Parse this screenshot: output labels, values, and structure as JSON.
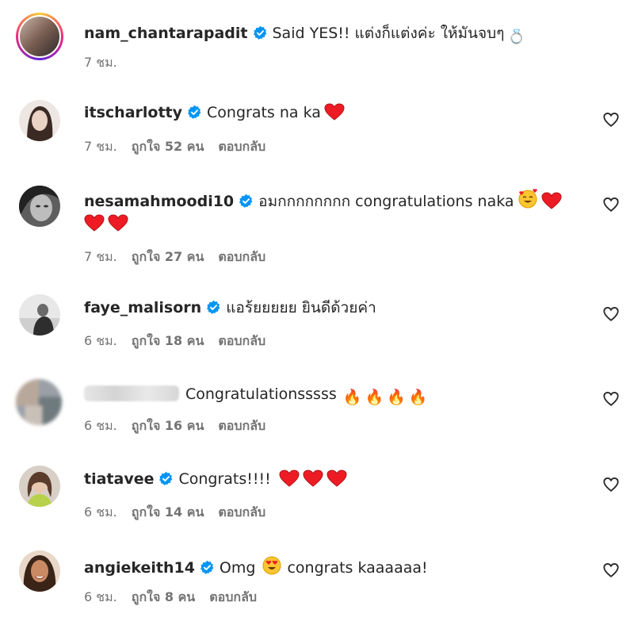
{
  "comments": [
    {
      "user": "nam_chantarapadit",
      "text": "Said YES!! แต่งก็แต่งค่ะ ให้มันจบๆ",
      "emoji": "💍",
      "time": "7 ชม."
    },
    {
      "user": "itscharlotty",
      "text": "Congrats na ka",
      "time": "7 ชม.",
      "likes": "ถูกใจ 52 คน",
      "reply": "ตอบกลับ"
    },
    {
      "user": "nesamahmoodi10",
      "text": "อมกกกกกกกก congratulations naka",
      "time": "7 ชม.",
      "likes": "ถูกใจ 27 คน",
      "reply": "ตอบกลับ"
    },
    {
      "user": "faye_malisorn",
      "text": "แอร้ยยยยย ยินดีด้วยค่า",
      "time": "6 ชม.",
      "likes": "ถูกใจ 18 คน",
      "reply": "ตอบกลับ"
    },
    {
      "user": "",
      "text": "Congratulationsssss",
      "time": "6 ชม.",
      "likes": "ถูกใจ 16 คน",
      "reply": "ตอบกลับ"
    },
    {
      "user": "tiatavee",
      "text": "Congrats!!!!",
      "time": "6 ชม.",
      "likes": "ถูกใจ 14 คน",
      "reply": "ตอบกลับ"
    },
    {
      "user": "angiekeith14",
      "text": "Omg",
      "text2": "congrats kaaaaaa!",
      "time": "6 ชม.",
      "likes": "ถูกใจ 8 คน",
      "reply": "ตอบกลับ"
    }
  ],
  "colors": {
    "verified": "#0095f6",
    "heart": "#ed1c24",
    "meta": "#737373"
  }
}
